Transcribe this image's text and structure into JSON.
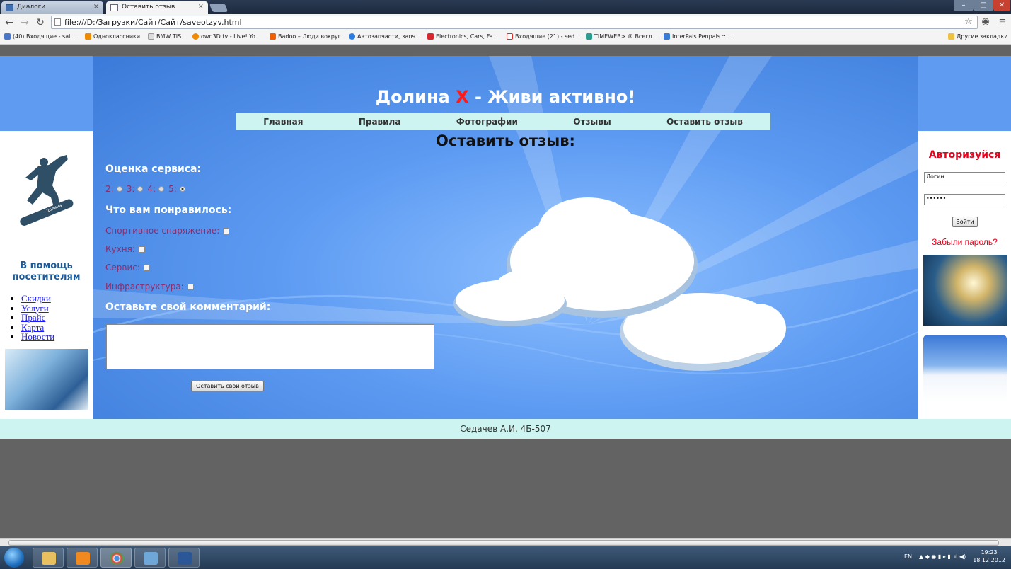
{
  "browser": {
    "tabs": [
      {
        "label": "Диалоги",
        "active": false
      },
      {
        "label": "Оставить отзыв",
        "active": true
      }
    ],
    "url": "file:///D:/Загрузки/Сайт/Сайт/saveotzyv.html",
    "bookmarks": [
      {
        "label": "(40) Входящие - sai...",
        "color": "#4a76c9"
      },
      {
        "label": "Одноклассники",
        "color": "#f08a00"
      },
      {
        "label": "BMW TIS.",
        "color": "#cccccc"
      },
      {
        "label": "own3D.tv - Live! Yo...",
        "color": "#f08a00"
      },
      {
        "label": "Badoo – Люди вокруг",
        "color": "#f06000"
      },
      {
        "label": "Автозапчасти, запч...",
        "color": "#2a7de1"
      },
      {
        "label": "Electronics, Cars, Fa...",
        "color": "#d9262c"
      },
      {
        "label": "Входящие (21) - sed...",
        "color": "#d93025"
      },
      {
        "label": "TIMEWEB> ® Всегд...",
        "color": "#2a9d8f"
      },
      {
        "label": "InterPals Penpals :: ...",
        "color": "#3a7bd5"
      }
    ],
    "other_bookmarks": "Другие закладки"
  },
  "site": {
    "title_pre": "Долина ",
    "title_x": "X",
    "title_post": " - Живи активно!",
    "menu": [
      "Главная",
      "Правила",
      "Фотографии",
      "Отзывы",
      "Оставить отзыв"
    ],
    "left": {
      "help_title": "В помощь посетителям",
      "links": [
        "Скидки",
        "Услуги",
        "Прайс",
        "Карта",
        "Новости"
      ]
    },
    "right": {
      "auth_title": "Авторизуйся",
      "login_value": "Логин",
      "password_value": "••••••",
      "login_button": "Войти",
      "forgot": "Забыли пароль?"
    },
    "form": {
      "title": "Оставить отзыв:",
      "rating_label": "Оценка сервиса:",
      "rating_options": [
        "2:",
        "3:",
        "4:",
        "5:"
      ],
      "rating_selected": "5",
      "likes_label": "Что вам понравилось:",
      "checkboxes": [
        "Спортивное снаряжение:",
        "Кухня:",
        "Сервис:",
        "Инфраструктура:"
      ],
      "comment_label": "Оставьте свой комментарий:",
      "submit": "Оставить свой отзыв"
    },
    "footer": "Седачев А.И. 4Б-507"
  },
  "taskbar": {
    "lang": "EN",
    "time": "19:23",
    "date": "18.12.2012"
  }
}
